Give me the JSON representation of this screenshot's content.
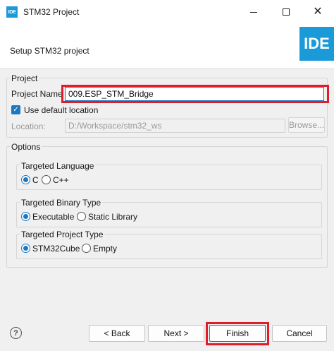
{
  "window": {
    "icon_text": "IDE",
    "title": "STM32 Project"
  },
  "banner": {
    "description": "Setup STM32 project",
    "logo_text": "IDE"
  },
  "project_group": {
    "title": "Project",
    "name_label": "Project Name",
    "name_value": "009.ESP_STM_Bridge",
    "use_default_label": "Use default location",
    "use_default_checked": true,
    "location_label": "Location:",
    "location_value": "D:/Workspace/stm32_ws",
    "browse_label": "Browse..."
  },
  "options_group": {
    "title": "Options",
    "language": {
      "title": "Targeted Language",
      "options": [
        "C",
        "C++"
      ],
      "selected": "C"
    },
    "binary": {
      "title": "Targeted Binary Type",
      "options": [
        "Executable",
        "Static Library"
      ],
      "selected": "Executable"
    },
    "project_type": {
      "title": "Targeted Project Type",
      "options": [
        "STM32Cube",
        "Empty"
      ],
      "selected": "STM32Cube"
    }
  },
  "footer": {
    "help_symbol": "?",
    "back_label": "< Back",
    "next_label": "Next >",
    "finish_label": "Finish",
    "cancel_label": "Cancel"
  },
  "colors": {
    "accent": "#1a78c2",
    "logo_blue": "#1a9ad6",
    "highlight_red": "#e01e2a"
  }
}
